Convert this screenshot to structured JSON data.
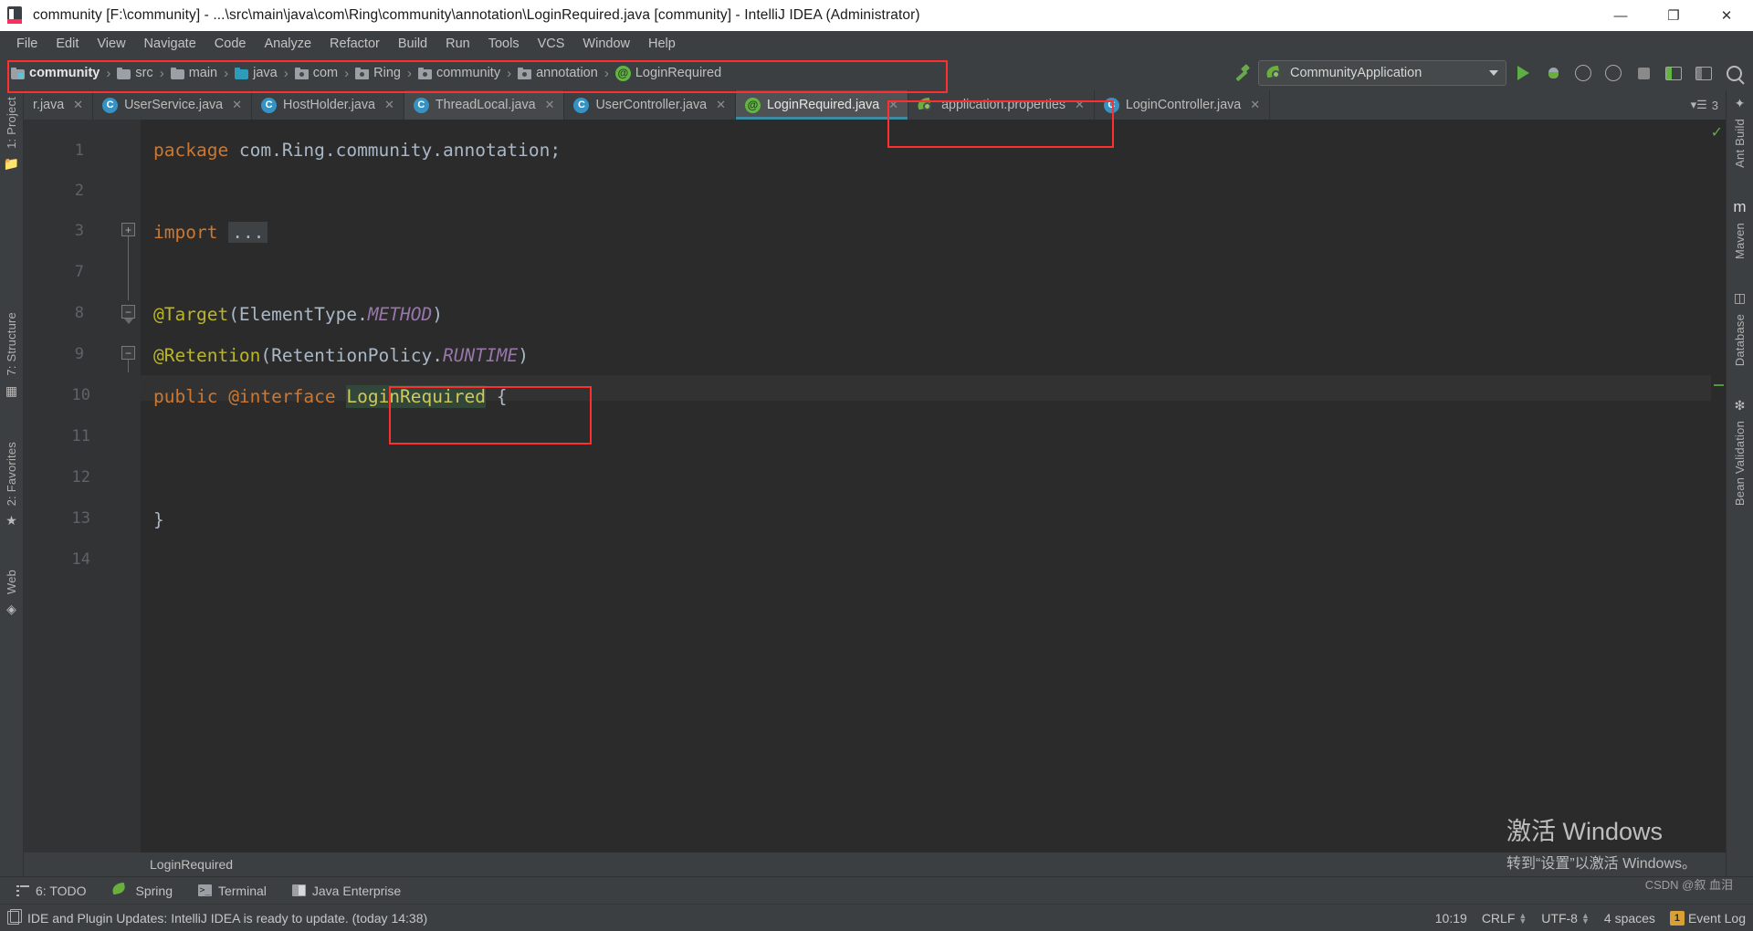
{
  "window": {
    "title": "community [F:\\community] - ...\\src\\main\\java\\com\\Ring\\community\\annotation\\LoginRequired.java [community] - IntelliJ IDEA (Administrator)",
    "minimize": "—",
    "maximize": "❐",
    "close": "✕"
  },
  "menu": {
    "items": [
      {
        "label": "File",
        "mnemonic": "F"
      },
      {
        "label": "Edit",
        "mnemonic": "E"
      },
      {
        "label": "View",
        "mnemonic": "V"
      },
      {
        "label": "Navigate",
        "mnemonic": "N"
      },
      {
        "label": "Code",
        "mnemonic": "C"
      },
      {
        "label": "Analyze",
        "mnemonic": "z"
      },
      {
        "label": "Refactor",
        "mnemonic": "R"
      },
      {
        "label": "Build",
        "mnemonic": "B"
      },
      {
        "label": "Run",
        "mnemonic": "R"
      },
      {
        "label": "Tools",
        "mnemonic": "T"
      },
      {
        "label": "VCS",
        "mnemonic": "S"
      },
      {
        "label": "Window",
        "mnemonic": "W"
      },
      {
        "label": "Help",
        "mnemonic": "H"
      }
    ]
  },
  "breadcrumb": {
    "separator": "›",
    "items": [
      {
        "label": "community",
        "icon": "module-folder-icon"
      },
      {
        "label": "src",
        "icon": "folder-icon"
      },
      {
        "label": "main",
        "icon": "folder-icon"
      },
      {
        "label": "java",
        "icon": "source-folder-icon"
      },
      {
        "label": "com",
        "icon": "package-icon"
      },
      {
        "label": "Ring",
        "icon": "package-icon"
      },
      {
        "label": "community",
        "icon": "package-icon"
      },
      {
        "label": "annotation",
        "icon": "package-icon"
      },
      {
        "label": "LoginRequired",
        "icon": "annotation-class-icon"
      }
    ]
  },
  "toolbar": {
    "build_hammer": "build-icon",
    "run_config": "CommunityApplication",
    "run": "run-icon",
    "debug": "debug-icon",
    "run_with_coverage": "coverage-icon",
    "profiler": "profiler-icon",
    "stop": "stop-icon",
    "layout_left": "layout-icon",
    "layout_right": "layout-icon",
    "search": "search-everywhere-icon"
  },
  "tabs": {
    "items": [
      {
        "label": "r.java",
        "icon": "java-class-icon",
        "active": false,
        "truncated": true
      },
      {
        "label": "UserService.java",
        "icon": "java-class-icon",
        "active": false
      },
      {
        "label": "HostHolder.java",
        "icon": "java-class-icon",
        "active": false
      },
      {
        "label": "ThreadLocal.java",
        "icon": "java-class-readonly-icon",
        "active": false
      },
      {
        "label": "UserController.java",
        "icon": "java-class-icon",
        "active": false
      },
      {
        "label": "LoginRequired.java",
        "icon": "java-annotation-icon",
        "active": true
      },
      {
        "label": "application.properties",
        "icon": "spring-properties-icon",
        "active": false
      },
      {
        "label": "LoginController.java",
        "icon": "java-class-icon",
        "active": false
      }
    ],
    "close_glyph": "✕",
    "overflow_label": "3",
    "overflow_icon": "tab-list-icon"
  },
  "editor": {
    "line_numbers": [
      "1",
      "2",
      "3",
      "7",
      "8",
      "9",
      "10",
      "11",
      "12",
      "13",
      "14"
    ],
    "lines": [
      {
        "num": "1",
        "tokens": [
          {
            "t": "package",
            "c": "kw"
          },
          {
            "t": " com.Ring.community.annotation;",
            "c": "plain"
          }
        ]
      },
      {
        "num": "2",
        "tokens": []
      },
      {
        "num": "3",
        "tokens": [
          {
            "t": "import",
            "c": "kw"
          },
          {
            "t": " ",
            "c": "plain"
          },
          {
            "t": "...",
            "c": "folded"
          }
        ]
      },
      {
        "num": "7",
        "tokens": []
      },
      {
        "num": "8",
        "tokens": [
          {
            "t": "@Target",
            "c": "ann"
          },
          {
            "t": "(ElementType.",
            "c": "plain"
          },
          {
            "t": "METHOD",
            "c": "sconst"
          },
          {
            "t": ")",
            "c": "plain"
          }
        ]
      },
      {
        "num": "9",
        "tokens": [
          {
            "t": "@Retention",
            "c": "ann"
          },
          {
            "t": "(RetentionPolicy.",
            "c": "plain"
          },
          {
            "t": "RUNTIME",
            "c": "sconst"
          },
          {
            "t": ")",
            "c": "plain"
          }
        ]
      },
      {
        "num": "10",
        "tokens": [
          {
            "t": "public ",
            "c": "kw"
          },
          {
            "t": "@interface",
            "c": "kw"
          },
          {
            "t": " ",
            "c": "plain"
          },
          {
            "t": "LoginRequired",
            "c": "hl-name"
          },
          {
            "t": " {",
            "c": "plain"
          }
        ]
      },
      {
        "num": "11",
        "tokens": []
      },
      {
        "num": "12",
        "tokens": []
      },
      {
        "num": "13",
        "tokens": [
          {
            "t": "}",
            "c": "plain"
          }
        ]
      },
      {
        "num": "14",
        "tokens": []
      }
    ],
    "folded_placeholder": "...",
    "fold_expand": "+",
    "fold_collapse": "−",
    "inspection_status": "ok",
    "inspection_glyph": "✓",
    "breadcrumb_bottom": "LoginRequired"
  },
  "left_strip": {
    "items": [
      {
        "label": "1: Project",
        "mnemonic": "1"
      },
      {
        "label": "7: Structure",
        "mnemonic": "7"
      },
      {
        "label": "2: Favorites",
        "mnemonic": "2"
      },
      {
        "label": "Web",
        "mnemonic": ""
      }
    ],
    "icons": [
      "folder-icon",
      "structure-icon",
      "star-icon",
      "web-icon"
    ]
  },
  "right_strip": {
    "items": [
      {
        "label": "Ant Build",
        "icon": "ant-icon"
      },
      {
        "label": "Maven",
        "icon": "maven-icon"
      },
      {
        "label": "Database",
        "icon": "database-icon"
      },
      {
        "label": "Bean Validation",
        "icon": "bean-validation-icon"
      }
    ]
  },
  "bottom_windows": {
    "items": [
      {
        "label": "6: TODO",
        "mnemonic": "6",
        "icon": "todo-list-icon"
      },
      {
        "label": "Spring",
        "mnemonic": "",
        "icon": "spring-leaf-icon"
      },
      {
        "label": "Terminal",
        "mnemonic": "",
        "icon": "terminal-icon"
      },
      {
        "label": "Java Enterprise",
        "mnemonic": "",
        "icon": "java-enterprise-icon"
      }
    ]
  },
  "statusbar": {
    "message": "IDE and Plugin Updates: IntelliJ IDEA is ready to update. (today 14:38)",
    "message_icon": "notification-icon",
    "caret_position": "10:19",
    "line_separator": "CRLF",
    "encoding": "UTF-8",
    "indent": "4 spaces",
    "event_log": "Event Log",
    "event_log_count": "1",
    "event_log_icon": "event-log-icon"
  },
  "watermark": {
    "line1": "激活 Windows",
    "line2": "转到“设置”以激活 Windows。",
    "credit": "CSDN @叙 血泪"
  },
  "colors": {
    "ide_bg": "#3c3f41",
    "editor_bg": "#2b2b2b",
    "accent_blue": "#3d8ba0",
    "annotation_red": "#ff2f2f",
    "keyword_orange": "#cc7832",
    "annotation_yellow": "#bbb529",
    "constant_purple": "#9876aa",
    "text_gray": "#a9b7c6",
    "green": "#62b543"
  }
}
